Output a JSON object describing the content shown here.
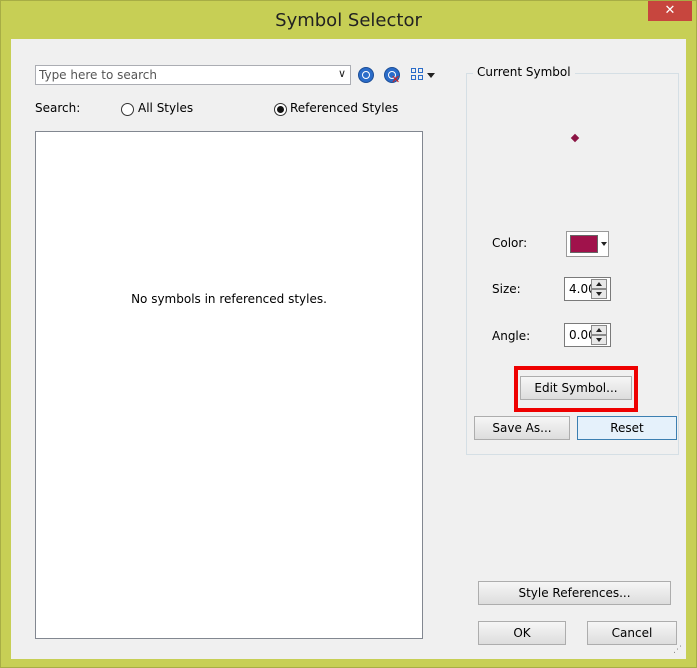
{
  "window": {
    "title": "Symbol Selector",
    "close_glyph": "✕"
  },
  "search": {
    "placeholder": "Type here to search",
    "value": "",
    "dropdown_icon": "chevron-down-icon",
    "search_icon": "search-icon",
    "clear_icon": "clear-search-icon",
    "view_icon": "grid-view-icon",
    "scope_label": "Search:",
    "options": [
      {
        "label": "All Styles",
        "selected": false
      },
      {
        "label": "Referenced Styles",
        "selected": true
      }
    ]
  },
  "symbol_list": {
    "empty_message": "No symbols in referenced styles."
  },
  "current_symbol": {
    "title": "Current Symbol",
    "preview_color": "#8b1444",
    "color_label": "Color:",
    "color_value": "#a0124b",
    "size_label": "Size:",
    "size_value": "4.00",
    "angle_label": "Angle:",
    "angle_value": "0.00",
    "edit_button": "Edit Symbol...",
    "save_as_button": "Save As...",
    "reset_button": "Reset"
  },
  "footer": {
    "style_references_button": "Style References...",
    "ok_button": "OK",
    "cancel_button": "Cancel"
  },
  "accent": {
    "title_bar": "#c7cf55",
    "highlight": "#ee0000",
    "close": "#c7463e"
  }
}
